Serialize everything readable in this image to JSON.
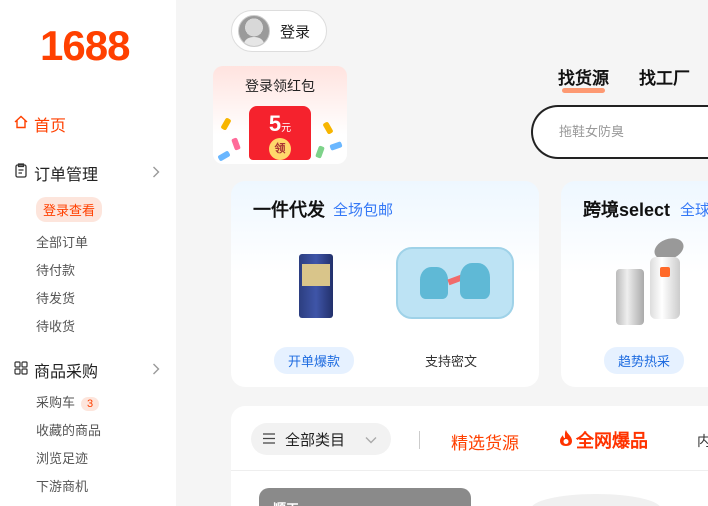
{
  "sidebar": {
    "logo": "1688",
    "home_label": "首页",
    "orders": {
      "title": "订单管理",
      "login_pill": "登录查看",
      "items": [
        "全部订单",
        "待付款",
        "待发货",
        "待收货"
      ]
    },
    "purchase": {
      "title": "商品采购",
      "items": [
        "采购车",
        "收藏的商品",
        "浏览足迹",
        "下游商机"
      ],
      "cart_count": "3"
    }
  },
  "header": {
    "login_label": "登录",
    "tabs": [
      "找货源",
      "找工厂"
    ],
    "active_tab": "找货源",
    "search_placeholder": "拖鞋女防臭"
  },
  "red_packet": {
    "title": "登录领红包",
    "amount": "5",
    "unit": "元",
    "button": "领"
  },
  "cards": [
    {
      "title": "一件代发",
      "subtitle": "全场包邮",
      "tags": [
        "开单爆款",
        "支持密文"
      ]
    },
    {
      "title": "跨境select",
      "subtitle": "全球",
      "tags": [
        "趋势热采"
      ]
    }
  ],
  "feed": {
    "category_button": "全部类目",
    "selected_label": "精选货源",
    "hot_label": "全网爆品",
    "more_label": "内",
    "thumb_text": "顺工"
  },
  "colors": {
    "brand": "#ff4000",
    "link_blue": "#3478f6",
    "tag_bg": "#e6f1ff"
  }
}
